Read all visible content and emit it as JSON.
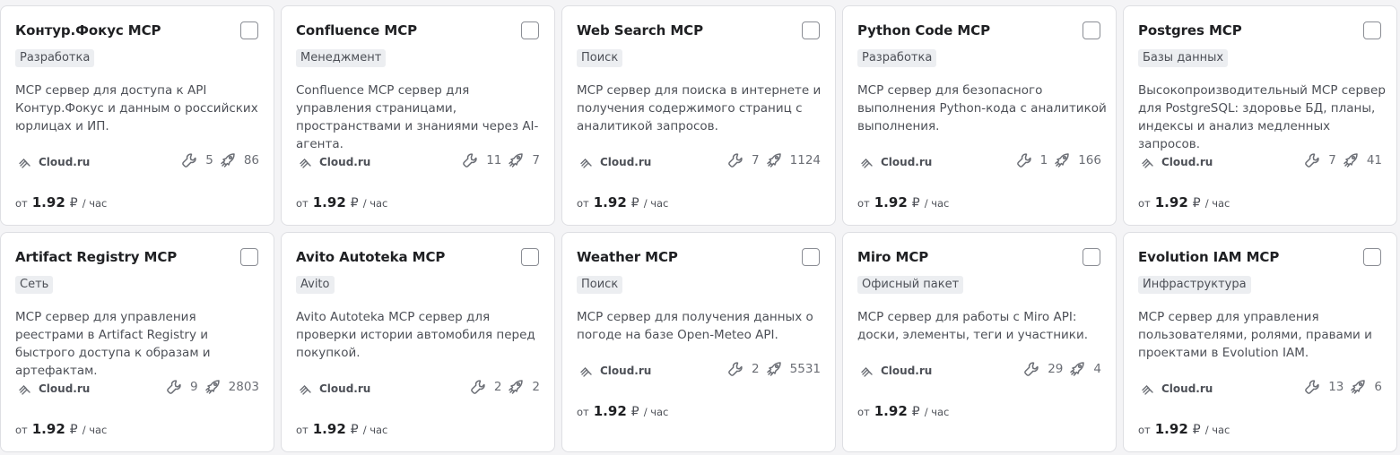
{
  "cards": [
    {
      "title": "Контур.Фокус MCP",
      "tag": "Разработка",
      "description": "MCP сервер для доступа к API Контур.Фокус и данным о российских юрлицах и ИП.",
      "provider": "Cloud.ru",
      "tools": "5",
      "deploys": "86",
      "price_prefix": "от",
      "price": "1.92",
      "currency": "₽",
      "unit": "/ час"
    },
    {
      "title": "Confluence MCP",
      "tag": "Менеджмент",
      "description": "Confluence MCP сервер для управления страницами, пространствами и знаниями через AI-агента.",
      "provider": "Cloud.ru",
      "tools": "11",
      "deploys": "7",
      "price_prefix": "от",
      "price": "1.92",
      "currency": "₽",
      "unit": "/ час"
    },
    {
      "title": "Web Search MCP",
      "tag": "Поиск",
      "description": "MCP сервер для поиска в интернете и получения содержимого страниц с аналитикой запросов.",
      "provider": "Cloud.ru",
      "tools": "7",
      "deploys": "1124",
      "price_prefix": "от",
      "price": "1.92",
      "currency": "₽",
      "unit": "/ час"
    },
    {
      "title": "Python Code MCP",
      "tag": "Разработка",
      "description": "MCP сервер для безопасного выполнения Python-кода с аналитикой выполнения.",
      "provider": "Cloud.ru",
      "tools": "1",
      "deploys": "166",
      "price_prefix": "от",
      "price": "1.92",
      "currency": "₽",
      "unit": "/ час"
    },
    {
      "title": "Postgres MCP",
      "tag": "Базы данных",
      "description": "Высокопроизводительный MCP сервер для PostgreSQL: здоровье БД, планы, индексы и анализ медленных запросов.",
      "provider": "Cloud.ru",
      "tools": "7",
      "deploys": "41",
      "price_prefix": "от",
      "price": "1.92",
      "currency": "₽",
      "unit": "/ час"
    },
    {
      "title": "Artifact Registry MCP",
      "tag": "Сеть",
      "description": "MCP сервер для управления реестрами в Artifact Registry и быстрого доступа к образам и артефактам.",
      "provider": "Cloud.ru",
      "tools": "9",
      "deploys": "2803",
      "price_prefix": "от",
      "price": "1.92",
      "currency": "₽",
      "unit": "/ час"
    },
    {
      "title": "Avito Autoteka MCP",
      "tag": "Avito",
      "description": "Avito Autoteka MCP сервер для проверки истории автомобиля перед покупкой.",
      "provider": "Cloud.ru",
      "tools": "2",
      "deploys": "2",
      "price_prefix": "от",
      "price": "1.92",
      "currency": "₽",
      "unit": "/ час"
    },
    {
      "title": "Weather MCP",
      "tag": "Поиск",
      "description": "MCP сервер для получения данных о погоде на базе Open-Meteo API.",
      "provider": "Cloud.ru",
      "tools": "2",
      "deploys": "5531",
      "price_prefix": "от",
      "price": "1.92",
      "currency": "₽",
      "unit": "/ час"
    },
    {
      "title": "Miro MCP",
      "tag": "Офисный пакет",
      "description": "MCP сервер для работы с Miro API: доски, элементы, теги и участники.",
      "provider": "Cloud.ru",
      "tools": "29",
      "deploys": "4",
      "price_prefix": "от",
      "price": "1.92",
      "currency": "₽",
      "unit": "/ час"
    },
    {
      "title": "Evolution IAM MCP",
      "tag": "Инфраструктура",
      "description": "MCP сервер для управления пользователями, ролями, правами и проектами в Evolution IAM.",
      "provider": "Cloud.ru",
      "tools": "13",
      "deploys": "6",
      "price_prefix": "от",
      "price": "1.92",
      "currency": "₽",
      "unit": "/ час"
    }
  ],
  "icons": {
    "provider": "cloud-ru-logo-icon",
    "tools": "wrench-icon",
    "deploys": "rocket-icon"
  },
  "colors": {
    "card_bg": "#ffffff",
    "page_bg": "#f4f4f6",
    "tag_bg": "#eceef1",
    "text_primary": "#1f2023",
    "text_secondary": "#4d5057"
  }
}
